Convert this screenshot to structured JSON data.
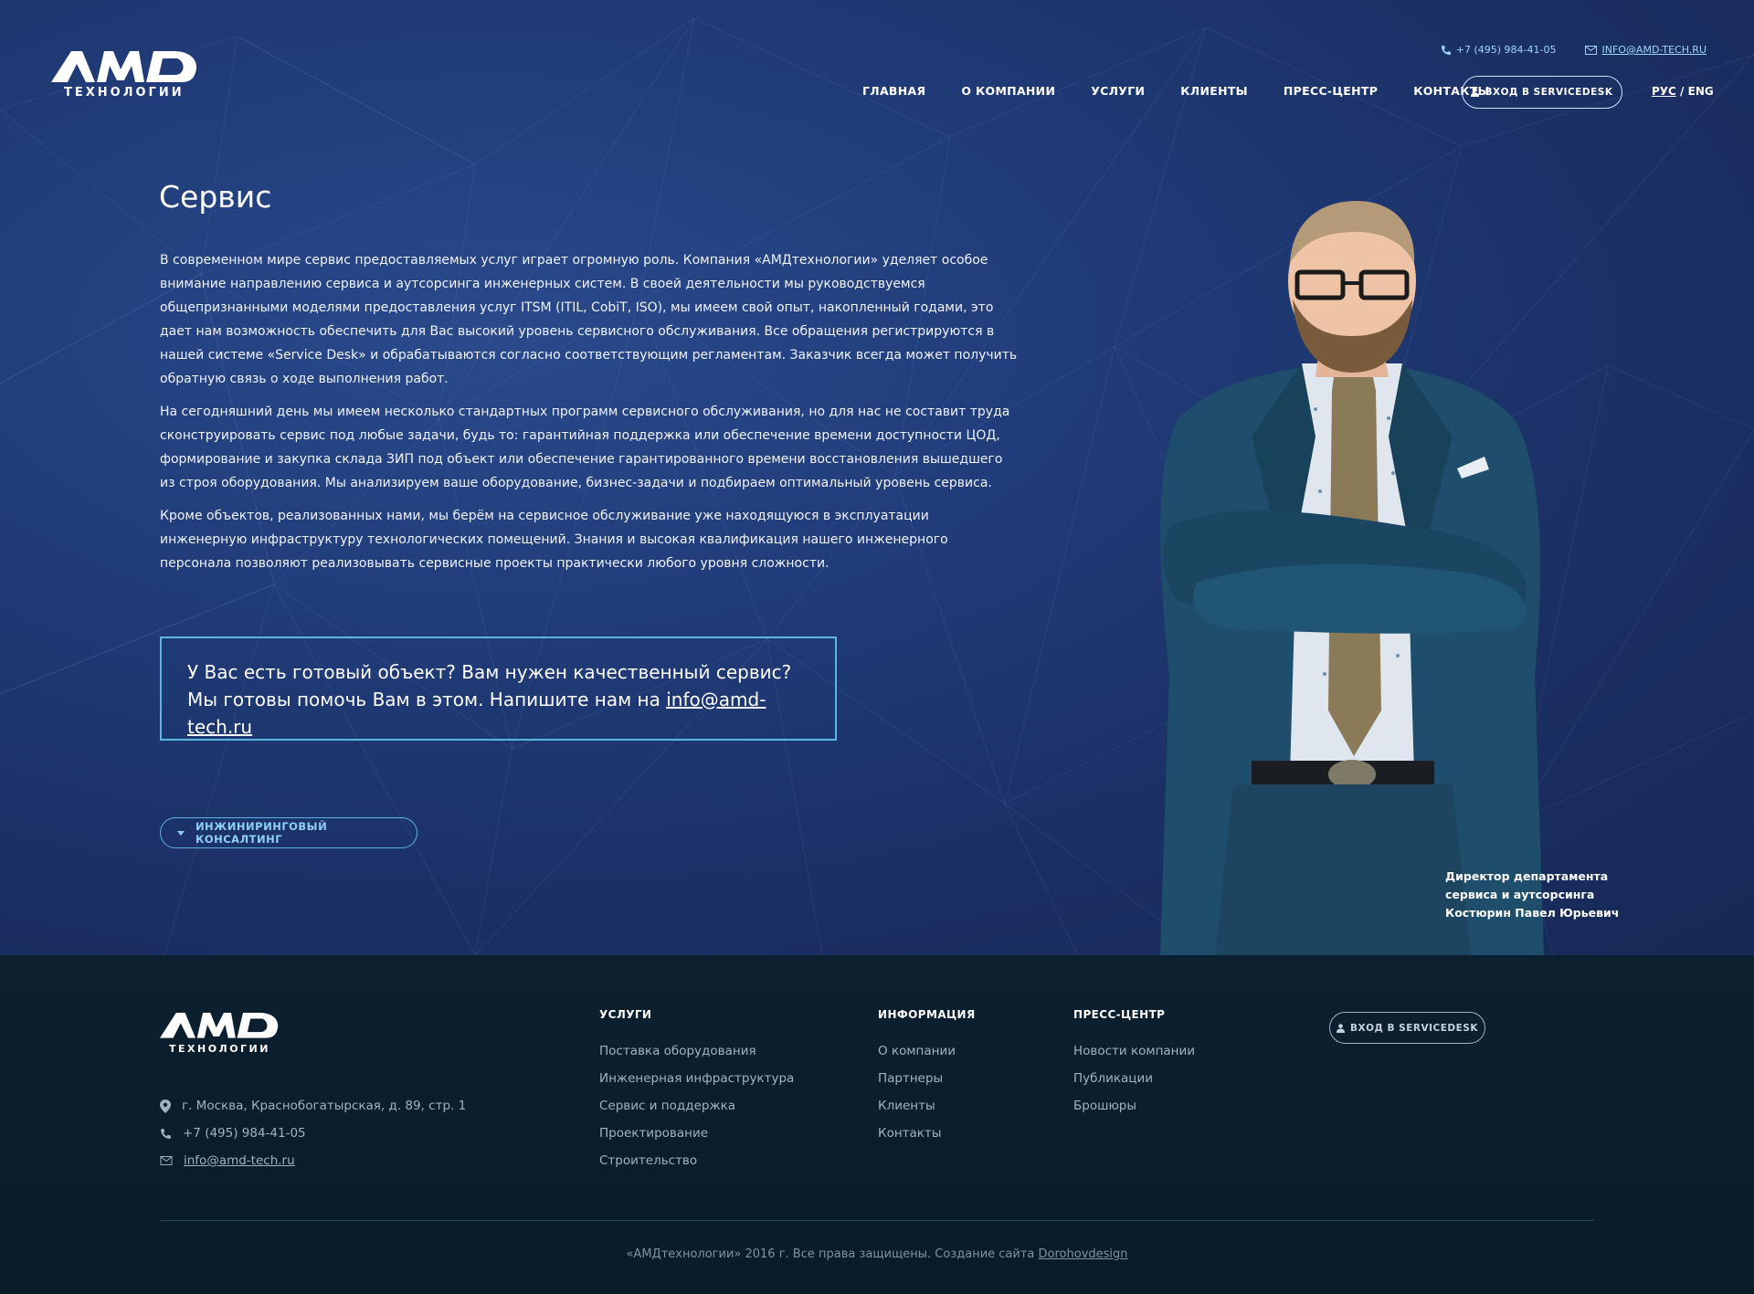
{
  "header": {
    "logo_text": "AMD",
    "logo_subtitle": "ТЕХНОЛОГИИ",
    "phone": "+7 (495) 984-41-05",
    "email": "INFO@AMD-TECH.RU",
    "nav": [
      "ГЛАВНАЯ",
      "О КОМПАНИИ",
      "УСЛУГИ",
      "КЛИЕНТЫ",
      "ПРЕСС-ЦЕНТР",
      "КОНТАКТЫ"
    ],
    "servicedesk_label": "ВХОД В SERVICEDESK",
    "lang_active": "РУС",
    "lang_separator": "/",
    "lang_other": "ENG"
  },
  "main": {
    "title": "Сервис",
    "paragraphs": [
      "В современном мире сервис предоставляемых услуг играет огромную роль. Компания «АМДтехнологии» уделяет особое внимание направлению сервиса и аутсорсинга инженерных систем. В своей деятельности мы руководствуемся общепризнанными моделями предоставления услуг ITSM (ITIL, CobiT, ISO), мы имеем свой опыт, накопленный годами, это дает нам возможность обеспечить для Вас высокий уровень сервисного обслуживания. Все обращения регистрируются в нашей системе «Service Desk» и обрабатываются согласно соответствующим регламентам. Заказчик всегда может получить обратную связь о ходе выполнения работ.",
      "На сегодняшний день мы имеем несколько стандартных программ сервисного обслуживания, но для нас не составит труда сконструировать сервис под любые задачи, будь то: гарантийная поддержка или обеспечение времени доступности ЦОД, формирование и закупка склада ЗИП под объект или обеспечение гарантированного времени восстановления вышедшего из строя оборудования. Мы анализируем ваше оборудование, бизнес-задачи и подбираем оптимальный уровень сервиса.",
      "Кроме объектов, реализованных нами, мы берём на сервисное обслуживание уже находящуюся в эксплуатации инженерную инфраструктуру технологических помещений. Знания и высокая квалификация нашего инженерного персонала позволяют реализовывать сервисные проекты практически любого уровня сложности."
    ],
    "cta_line1": "У Вас есть готовый объект? Вам нужен качественный сервис?",
    "cta_line2_prefix": "Мы готовы помочь Вам в этом. Напишите нам на",
    "cta_email": "info@amd-tech.ru",
    "consulting_label": "ИНЖИНИРИНГОВЫЙ КОНСАЛТИНГ",
    "caption": [
      "Директор департамента",
      "сервиса и аутсорсинга",
      "Костюрин Павел Юрьевич"
    ]
  },
  "footer": {
    "logo_text": "AMD",
    "logo_subtitle": "ТЕХНОЛОГИИ",
    "address": "г. Москва, Краснобогатырская, д. 89, стр. 1",
    "phone": "+7 (495) 984-41-05",
    "email": "info@amd-tech.ru",
    "columns": [
      {
        "title": "УСЛУГИ",
        "links": [
          "Поставка оборудования",
          "Инженерная инфраструктура",
          "Сервис и поддержка",
          "Проектирование",
          "Строительство"
        ]
      },
      {
        "title": "ИНФОРМАЦИЯ",
        "links": [
          "О компании",
          "Партнеры",
          "Клиенты",
          "Контакты"
        ]
      },
      {
        "title": "ПРЕСС-ЦЕНТР",
        "links": [
          "Новости компании",
          "Публикации",
          "Брошюры"
        ]
      }
    ],
    "servicedesk_label": "ВХОД В SERVICEDESK",
    "copyright_text": "«АМДтехнологии» 2016 г. Все права защищены. Создание сайта",
    "copyright_author": "Dorohovdesign"
  },
  "colors": {
    "hero_bg": "#203b78",
    "accent": "#5cb6e4",
    "footer_bg": "#0c2030"
  },
  "icons": [
    "phone-icon",
    "mail-icon",
    "user-icon",
    "chevron-down-icon",
    "location-icon"
  ]
}
